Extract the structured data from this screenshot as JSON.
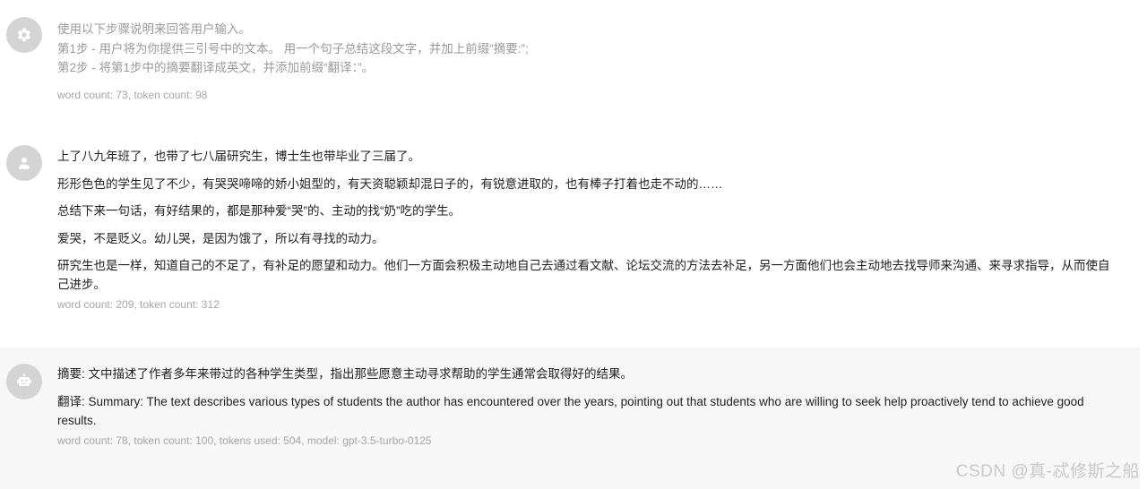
{
  "messages": {
    "system": {
      "lines": [
        "使用以下步骤说明来回答用户输入。",
        "第1步 - 用户将为你提供三引号中的文本。 用一个句子总结这段文字，并加上前缀“摘要:”;",
        "第2步 - 将第1步中的摘要翻译成英文，并添加前缀“翻译：”。"
      ],
      "meta": "word count: 73, token count: 98"
    },
    "user": {
      "paragraphs": [
        "上了八九年班了，也带了七八届研究生，博士生也带毕业了三届了。",
        "形形色色的学生见了不少，有哭哭啼啼的娇小姐型的，有天资聪颖却混日子的，有锐意进取的，也有棒子打着也走不动的……",
        "总结下来一句话，有好结果的，都是那种爱“哭”的、主动的找“奶”吃的学生。",
        "爱哭，不是贬义。幼儿哭，是因为饿了，所以有寻找的动力。",
        "研究生也是一样，知道自己的不足了，有补足的愿望和动力。他们一方面会积极主动地自己去通过看文献、论坛交流的方法去补足，另一方面他们也会主动地去找导师来沟通、来寻求指导，从而使自己进步。"
      ],
      "meta": "word count: 209, token count: 312"
    },
    "assistant": {
      "paragraphs": [
        "摘要: 文中描述了作者多年来带过的各种学生类型，指出那些愿意主动寻求帮助的学生通常会取得好的结果。",
        "翻译: Summary: The text describes various types of students the author has encountered over the years, pointing out that students who are willing to seek help proactively tend to achieve good results."
      ],
      "meta": "word count: 78, token count: 100, tokens used: 504, model: gpt-3.5-turbo-0125"
    }
  },
  "icons": {
    "system": "gear-icon",
    "user": "person-icon",
    "assistant": "robot-icon"
  },
  "colors": {
    "avatar_bg": "#d4d4d4",
    "assistant_row_bg": "#f7f7f8",
    "meta_text": "#a6a6a6"
  },
  "watermark": "CSDN @真-忒修斯之船"
}
